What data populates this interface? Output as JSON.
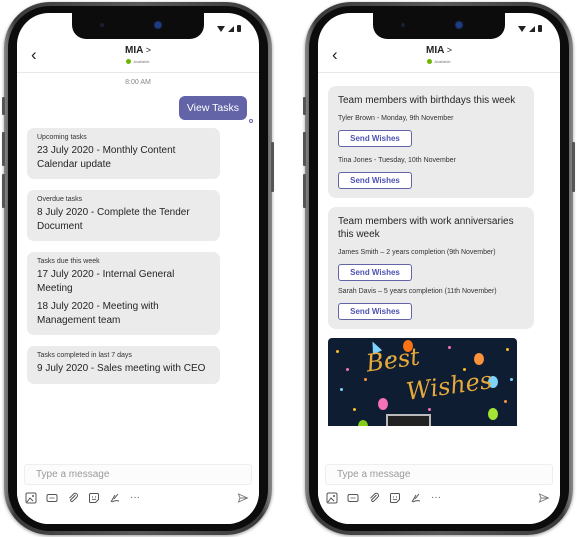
{
  "left_phone": {
    "header": {
      "back_icon": "chevron-left-icon",
      "back_glyph": "‹",
      "title": "MIA",
      "title_chevron": ">",
      "presence": "Available",
      "presence_color": "#6bb700"
    },
    "timestamp": "8:00 AM",
    "sent_message": "View Tasks",
    "cards": [
      {
        "label": "Upcoming tasks",
        "items": [
          "23 July 2020 - Monthly Content Calendar update"
        ]
      },
      {
        "label": "Overdue tasks",
        "items": [
          "8 July 2020 - Complete the Tender Document"
        ]
      },
      {
        "label": "Tasks due this week",
        "items": [
          "17 July 2020 - Internal General Meeting",
          "18 July 2020 - Meeting with Management team"
        ]
      },
      {
        "label": "Tasks completed in last 7 days",
        "items": [
          "9 July 2020 - Sales meeting with CEO"
        ]
      }
    ],
    "composer": {
      "placeholder": "Type a message",
      "more_glyph": "···"
    }
  },
  "right_phone": {
    "header": {
      "back_glyph": "‹",
      "title": "MIA",
      "title_chevron": ">",
      "presence": "Available"
    },
    "birthdays_card": {
      "heading": "Team members with birthdays this week",
      "people": [
        {
          "text": "Tyler Brown - Monday, 9th November",
          "button": "Send Wishes"
        },
        {
          "text": "Tina Jones - Tuesday, 10th November",
          "button": "Send Wishes"
        }
      ]
    },
    "anniversaries_card": {
      "heading": "Team members with work anniversaries this week",
      "people": [
        {
          "text": "James Smith – 2 years completion (9th November)",
          "button": "Send Wishes"
        },
        {
          "text": "Sarah Davis – 5 years completion (11th November)",
          "button": "Send Wishes"
        }
      ]
    },
    "greeting_image": {
      "line1": "Best",
      "line2": "Wishes"
    },
    "composer": {
      "placeholder": "Type a message",
      "more_glyph": "···"
    }
  },
  "colors": {
    "accent": "#6264a7",
    "card_bg": "#ebebeb",
    "presence": "#6bb700",
    "greeting_bg": "#0f1d33",
    "greeting_text": "#e6a93a"
  }
}
